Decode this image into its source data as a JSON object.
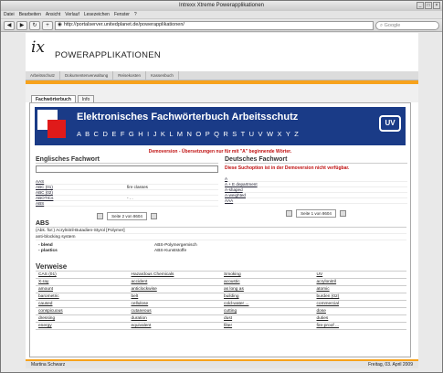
{
  "window": {
    "title": "Intrexx Xtreme Powerapplikationen"
  },
  "menu": [
    "Datei",
    "Bearbeiten",
    "Ansicht",
    "Verlauf",
    "Lesezeichen",
    "Fenster",
    "?"
  ],
  "toolbar": {
    "url": "http://portalserver.unitedplanet.de/powerapplikationen/",
    "search_placeholder": "Google",
    "icons": [
      "back-icon",
      "forward-icon",
      "reload-icon",
      "add-icon"
    ]
  },
  "header": {
    "logo": "ix",
    "app_title": "POWERAPPLIKATIONEN"
  },
  "nav": [
    "Arbeitsschutz",
    "Dokumentenverwaltung",
    "Reisekosten",
    "Kassenbuch"
  ],
  "tabs": [
    "Fachwörterbuch",
    "Info"
  ],
  "banner": {
    "title": "Elektronisches Fachwörterbuch Arbeitsschutz",
    "alphabet": "A B C D E F G H I J K L M N O P Q R S T U V W X Y Z",
    "badge": "UV"
  },
  "demo_notice": "Demoversion - Übersetzungen nur für mit \"A\" beginnende Wörter.",
  "left": {
    "heading": "Englisches Fachwort",
    "items": [
      [
        "AAS",
        ""
      ],
      [
        "ABC (01)",
        "fire classes"
      ],
      [
        "ABC (02)",
        ""
      ],
      [
        "ABOTICs",
        "- . ."
      ],
      [
        "ABS",
        ""
      ]
    ],
    "pager": "Seite 2 von 8604"
  },
  "right": {
    "heading": "Deutsches Fachwort",
    "warning": "Diese Suchoption ist in der Demoversion nicht verfügbar.",
    "items": [
      "A",
      "A + E department",
      "A-shaped",
      "A-weighted",
      "AAA"
    ],
    "pager": "Seite 1 von 8604"
  },
  "abs": {
    "heading": "ABS",
    "line1": "(Abk. für:) Acrylnitril-Butadien-Styrol [Polymer]",
    "line2": "anti-blocking system",
    "pairs": [
      [
        "- blend",
        "ABS-Polymergemisch"
      ],
      [
        "- plastics",
        "ABS-Kunststoffe"
      ]
    ]
  },
  "verweise": {
    "heading": "Verweise",
    "words": [
      "CAS (01)",
      "Hazardous Chemicals",
      "Smoking",
      "UV",
      "X-ray",
      "accident",
      "acoustic",
      "acrylonitril",
      "amount",
      "anticlockwise",
      "as long as",
      "atomic",
      "barometric",
      "belt",
      "building",
      "burden (02)",
      "caused",
      "cellulose",
      "cold-water ...",
      "commercial",
      "conspicuous",
      "cutaneous",
      "cutting",
      "dose",
      "dressing",
      "duration",
      "dust",
      "duties",
      "energy",
      "equivalent",
      "filter",
      "fire-proof ..."
    ]
  },
  "footer": {
    "user": "Martina Schwarz",
    "date": "Freitag, 03. April 2009"
  }
}
